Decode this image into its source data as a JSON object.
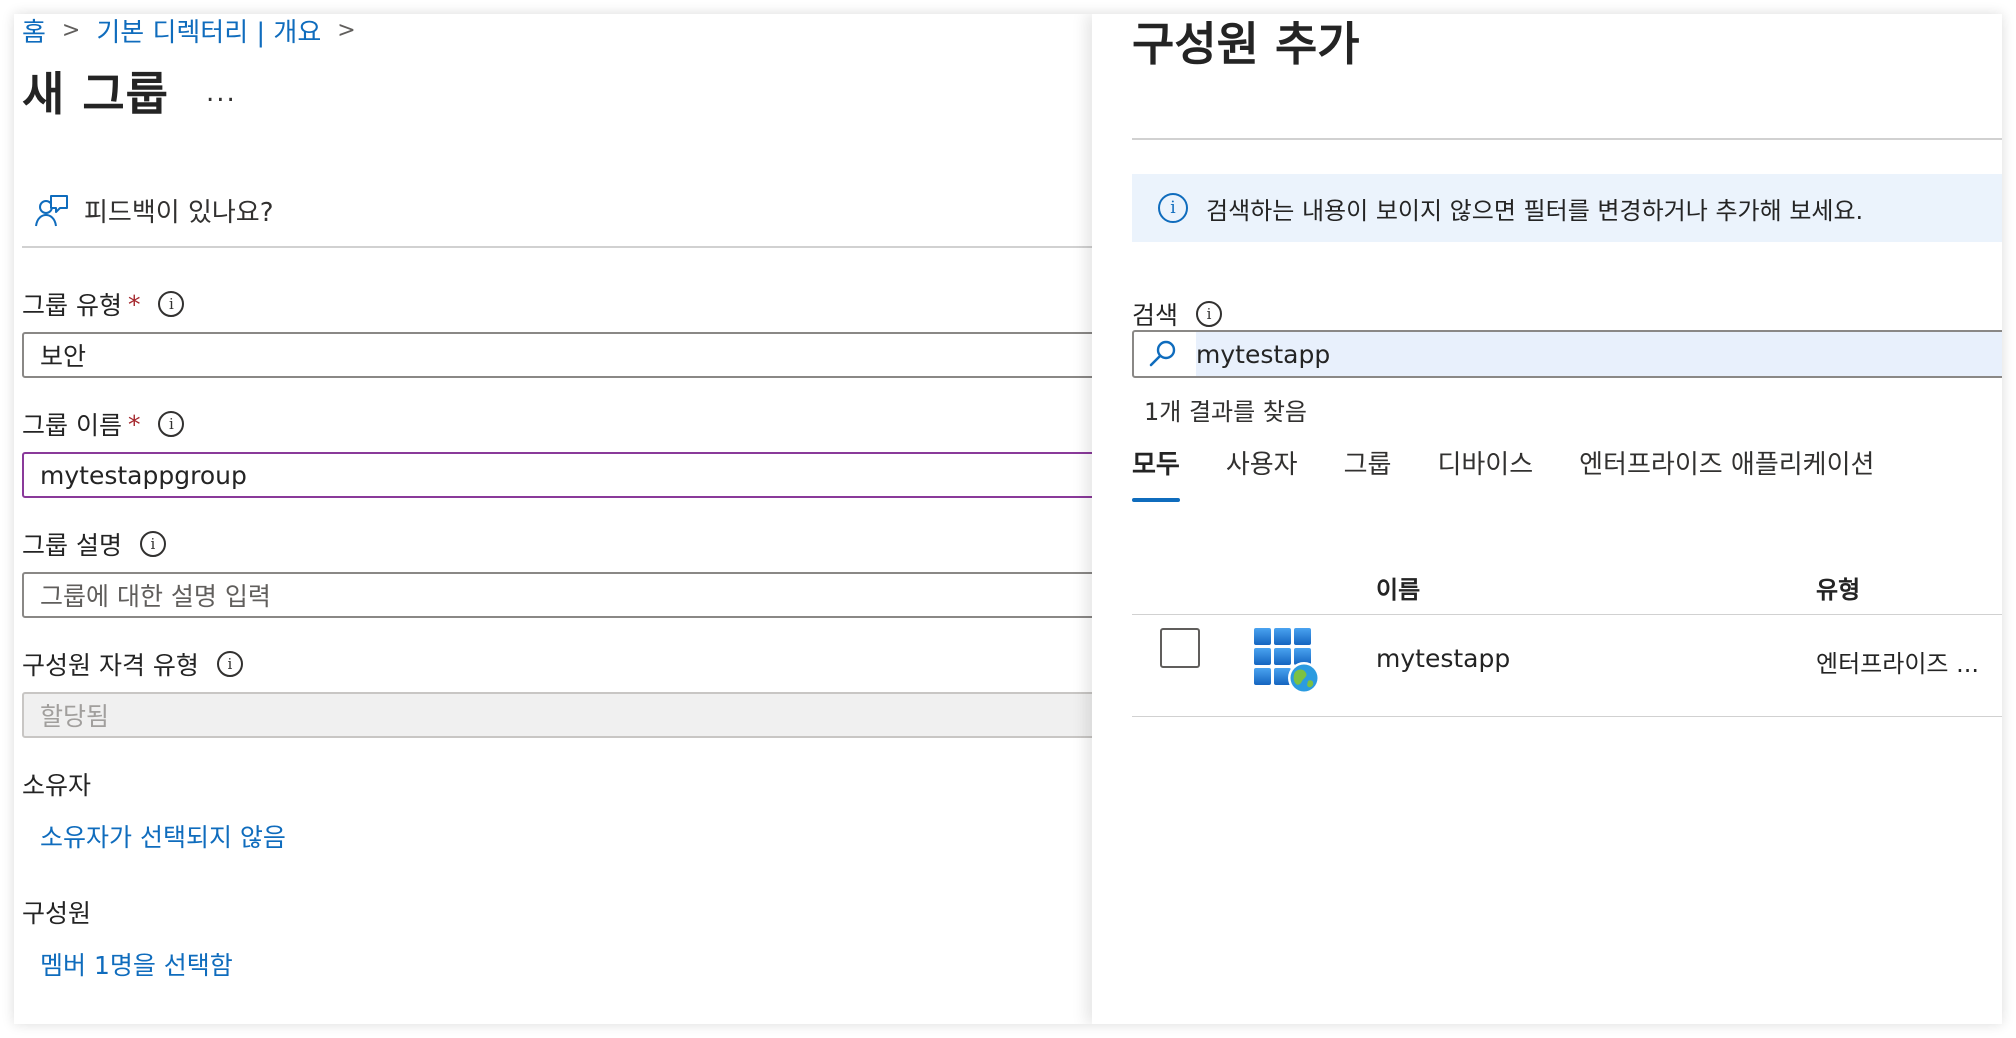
{
  "breadcrumb": {
    "items": [
      "홈",
      "기본 디렉터리 | 개요"
    ],
    "separator": ">"
  },
  "page": {
    "title": "새 그룹",
    "more_label": "..."
  },
  "feedback": {
    "label": "피드백이 있나요?",
    "icon": "feedback-person-icon"
  },
  "form": {
    "group_type": {
      "label": "그룹 유형",
      "required": "*",
      "value": "보안"
    },
    "group_name": {
      "label": "그룹 이름",
      "required": "*",
      "value": "mytestappgroup"
    },
    "group_description": {
      "label": "그룹 설명",
      "placeholder": "그룹에 대한 설명 입력"
    },
    "membership_type": {
      "label": "구성원 자격 유형",
      "value": "할당됨"
    },
    "owners": {
      "label": "소유자",
      "link": "소유자가 선택되지 않음"
    },
    "members": {
      "label": "구성원",
      "link": "멤버 1명을 선택함"
    },
    "info_symbol": "i"
  },
  "panel": {
    "title": "구성원 추가",
    "info_message": "검색하는 내용이 보이지 않으면 필터를 변경하거나 추가해 보세요.",
    "search_label": "검색",
    "search_value": "mytestapp",
    "result_count": "1개 결과를 찾음",
    "tabs": [
      {
        "label": "모두",
        "active": true
      },
      {
        "label": "사용자",
        "active": false
      },
      {
        "label": "그룹",
        "active": false
      },
      {
        "label": "디바이스",
        "active": false
      },
      {
        "label": "엔터프라이즈 애플리케이션",
        "active": false
      }
    ],
    "table": {
      "headers": {
        "name": "이름",
        "type": "유형"
      },
      "rows": [
        {
          "name": "mytestapp",
          "type": "엔터프라이즈 ...",
          "icon": "enterprise-app-globe-icon",
          "checked": false
        }
      ]
    }
  },
  "colors": {
    "link": "#0f6cbd",
    "required": "#a4262c",
    "focus_border": "#8a3a9a",
    "info_bar_bg": "#ebf3fc"
  }
}
